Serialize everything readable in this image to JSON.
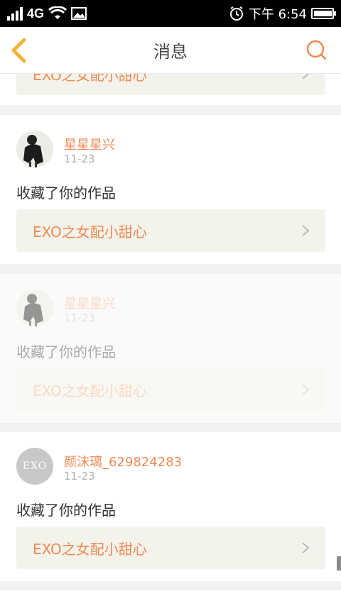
{
  "status_bar": {
    "network": "4G",
    "time": "下午 6:54"
  },
  "header": {
    "title": "消息",
    "back_icon": "chevron-left-icon",
    "search_icon": "search-icon",
    "accent_color": "#f6b33c",
    "search_color": "#f08a52"
  },
  "work_title": "EXO之女配小甜心",
  "partial_card": {
    "work_title": "EXO之女配小甜心"
  },
  "messages": [
    {
      "username": "星星星兴",
      "date": "11-23",
      "action": "收藏了你的作品",
      "work_title": "EXO之女配小甜心",
      "avatar": "photo-avatar"
    },
    {
      "username": "星星星兴",
      "date": "11-23",
      "action": "收藏了你的作品",
      "work_title": "EXO之女配小甜心",
      "avatar": "photo-avatar"
    },
    {
      "username": "颜沫璃_629824283",
      "date": "11-23",
      "action": "收藏了你的作品",
      "work_title": "EXO之女配小甜心",
      "avatar": "exo-avatar",
      "avatar_text": "EXO"
    }
  ]
}
